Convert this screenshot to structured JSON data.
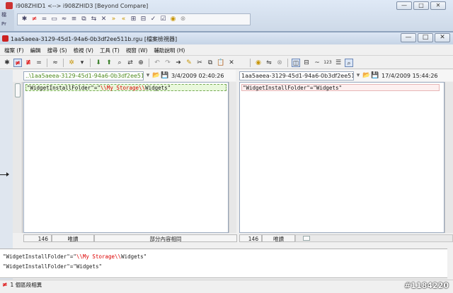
{
  "background_window": {
    "title": "i908ZHID1 <--> i908ZHID3 [Beyond Compare]",
    "strip_label_1": "檔",
    "strip_label_2": "Pr",
    "caption_buttons": [
      "—",
      "□",
      "✕"
    ]
  },
  "window": {
    "title": "1aa5aeea-3129-45d1-94a6-0b3df2ee511b.rgu [檔案檢視器]",
    "caption_buttons": [
      "—",
      "□",
      "✕"
    ]
  },
  "menu": [
    "檔案 (F)",
    "編輯",
    "搜尋 (S)",
    "檢視 (V)",
    "工具 (T)",
    "視窗 (W)",
    "輔助說明 (H)"
  ],
  "toolbar_icons": [
    "asterisk-icon",
    "not-equal-icon",
    "not-equal-filter-icon",
    "equal-icon",
    "approx-icon",
    "tools-icon",
    "next-diff-icon",
    "prev-diff-icon",
    "find-icon",
    "replace-icon",
    "find-next-icon",
    "undo-icon",
    "redo-icon",
    "copy-right-icon",
    "pen-icon",
    "cut-icon",
    "copy-icon",
    "paste-icon",
    "delete-icon"
  ],
  "left_path": {
    "value": "..\\1aa5aeea-3129-45d1-94a6-0b3df2ee51",
    "date": "3/4/2009 02:40:26"
  },
  "right_path": {
    "value": "1aa5aeea-3129-45d1-94a6-0b3df2ee511",
    "date": "17/4/2009 15:44:26"
  },
  "left_pane": {
    "line_prefix": "\"WidgetInstallFolder\"=\"",
    "line_diff": "\\\\My Storage\\\\",
    "line_suffix": "Widgets\""
  },
  "right_pane": {
    "line": "\"WidgetInstallFolder\"=\"Widgets\""
  },
  "left_status": {
    "line_no": "146",
    "mode": "唯讀",
    "summary": "部分內容相同"
  },
  "right_status": {
    "line_no": "146",
    "mode": "唯讀"
  },
  "detail": {
    "line1_prefix": "\"WidgetInstallFolder\"=\"",
    "line1_diff": "\\\\My Storage\\\\",
    "line1_suffix": "Widgets\"",
    "line2": "\"WidgetInstallFolder\"=\"Widgets\""
  },
  "statusbar": {
    "symbol": "≠",
    "text": "1 個區段相異"
  },
  "watermark": "#1184220",
  "colors": {
    "diff_red": "#dd0000",
    "left_path_green": "#4e8a1e",
    "left_line_bg": "#e9f8dc",
    "right_line_bg": "#fdf0f0"
  }
}
